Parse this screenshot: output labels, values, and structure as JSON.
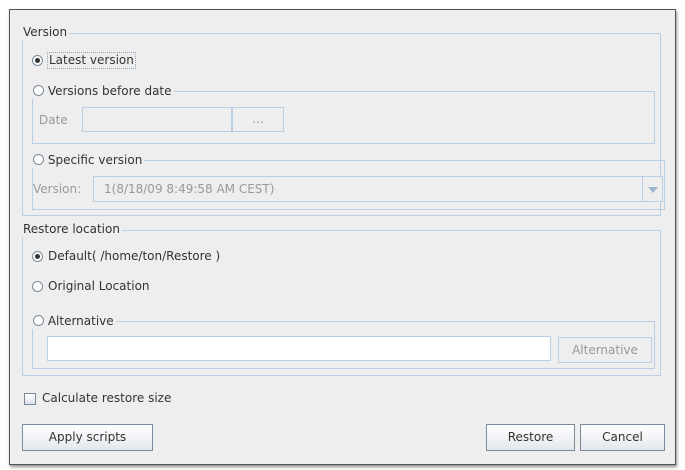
{
  "version_group": {
    "title": "Version",
    "latest_label": "Latest version",
    "before_date_label": "Versions before date",
    "date_label": "Date",
    "date_picker_label": "...",
    "specific_label": "Specific version",
    "version_label": "Version:",
    "version_selected": "1(8/18/09 8:49:58 AM CEST)"
  },
  "location_group": {
    "title": "Restore location",
    "default_label": "Default( /home/ton/Restore )",
    "original_label": "Original Location",
    "alternative_label": "Alternative",
    "alternative_path": "",
    "alternative_button": "Alternative"
  },
  "calculate_label": "Calculate restore size",
  "buttons": {
    "apply_scripts": "Apply scripts",
    "restore": "Restore",
    "cancel": "Cancel"
  }
}
